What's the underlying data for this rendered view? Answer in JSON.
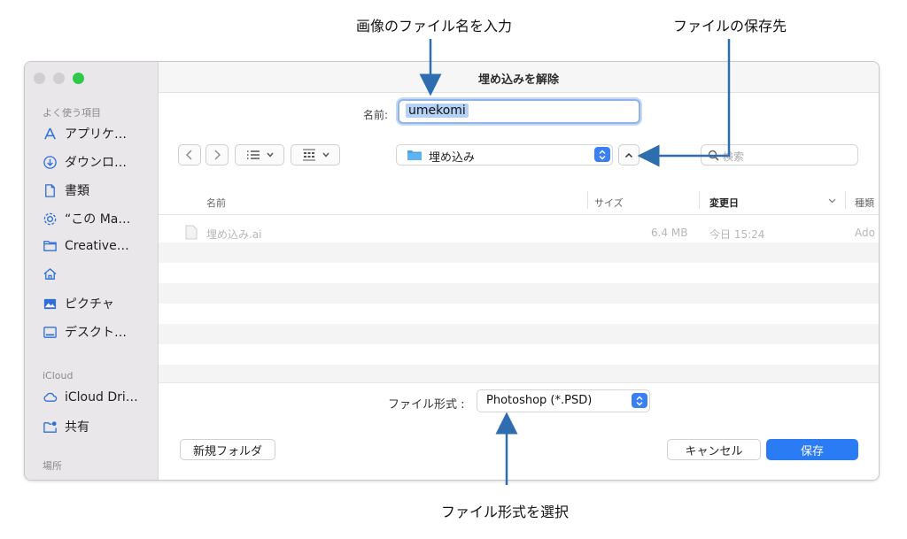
{
  "annotations": {
    "filename_note": "画像のファイル名を入力",
    "location_note": "ファイルの保存先",
    "format_note": "ファイル形式を選択"
  },
  "dialog": {
    "title": "埋め込みを解除",
    "name_label": "名前:",
    "filename": "umekomi",
    "location": "埋め込み",
    "search_placeholder": "検索"
  },
  "sidebar": {
    "favorites_heading": "よく使う項目",
    "favorites": [
      {
        "label": "アプリケ…",
        "icon": "applications-icon"
      },
      {
        "label": "ダウンロ…",
        "icon": "downloads-icon"
      },
      {
        "label": "書類",
        "icon": "documents-icon"
      },
      {
        "label": "“この Ma…",
        "icon": "computer-gear-icon"
      },
      {
        "label": "Creative…",
        "icon": "folder-icon"
      },
      {
        "label": "",
        "icon": "home-icon"
      },
      {
        "label": "ピクチャ",
        "icon": "pictures-icon"
      },
      {
        "label": "デスクト…",
        "icon": "desktop-icon"
      }
    ],
    "icloud_heading": "iCloud",
    "icloud": [
      {
        "label": "iCloud Dri…",
        "icon": "cloud-icon"
      },
      {
        "label": "共有",
        "icon": "shared-folder-icon"
      }
    ],
    "locations_heading": "場所"
  },
  "columns": {
    "name": "名前",
    "size": "サイズ",
    "modified": "変更日",
    "kind": "種類"
  },
  "files": [
    {
      "name": "埋め込み.ai",
      "size": "6.4 MB",
      "modified": "今日 15:24",
      "kind": "Ado"
    }
  ],
  "footer": {
    "format_label": "ファイル形式 :",
    "format_value": "Photoshop (*.PSD)",
    "new_folder": "新規フォルダ",
    "cancel": "キャンセル",
    "save": "保存"
  },
  "colors": {
    "accent": "#2b7cf4",
    "annotation_arrow": "#2e6db0"
  }
}
